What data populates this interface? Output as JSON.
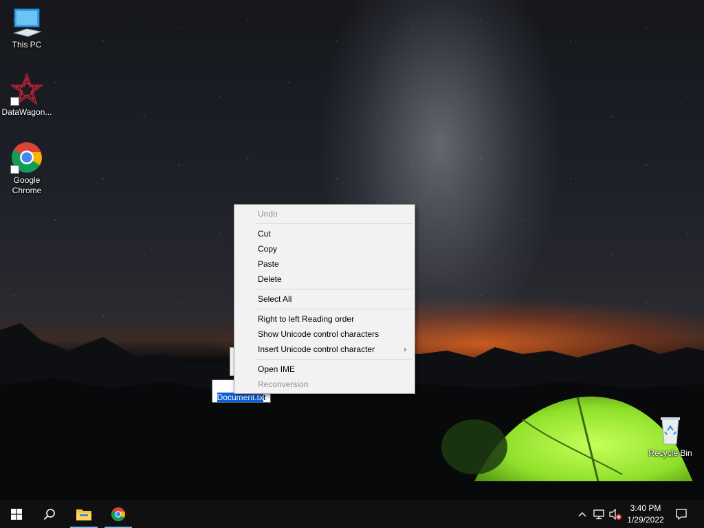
{
  "desktop": {
    "icons": [
      {
        "label": "This PC",
        "icon": "this-pc-icon"
      },
      {
        "label": "DataWagon...",
        "icon": "datawagon-icon"
      },
      {
        "label": "Google Chrome",
        "icon": "chrome-icon"
      },
      {
        "label": "Recycle Bin",
        "icon": "recycle-bin-icon"
      }
    ],
    "file": {
      "line1": "New Text",
      "line1_visible": "Ne",
      "line2_selected": "Document.tx",
      "line2_tail": "t"
    }
  },
  "context_menu": {
    "items": [
      {
        "label": "Undo",
        "enabled": false
      },
      {
        "label": "Cut",
        "enabled": true
      },
      {
        "label": "Copy",
        "enabled": true
      },
      {
        "label": "Paste",
        "enabled": true
      },
      {
        "label": "Delete",
        "enabled": true
      },
      {
        "label": "Select All",
        "enabled": true
      },
      {
        "label": "Right to left Reading order",
        "enabled": true
      },
      {
        "label": "Show Unicode control characters",
        "enabled": true
      },
      {
        "label": "Insert Unicode control character",
        "enabled": true,
        "submenu_arrow": "›"
      },
      {
        "label": "Open IME",
        "enabled": true
      },
      {
        "label": "Reconversion",
        "enabled": false
      }
    ]
  },
  "taskbar": {
    "buttons": [
      "start-windows-icon",
      "search-icon",
      "file-explorer-icon",
      "chrome-taskbar-icon"
    ],
    "tray": [
      "show-hidden-icons-chevron",
      "network-icon",
      "volume-muted-icon",
      "action-center-icon"
    ],
    "clock": {
      "time": "3:40 PM",
      "date": "1/29/2022"
    },
    "accent": "#76b9ed"
  },
  "colors": {
    "selection": "#0b5fd6",
    "menu_bg": "#f2f2f2",
    "tent_green": "#8fe02a"
  }
}
